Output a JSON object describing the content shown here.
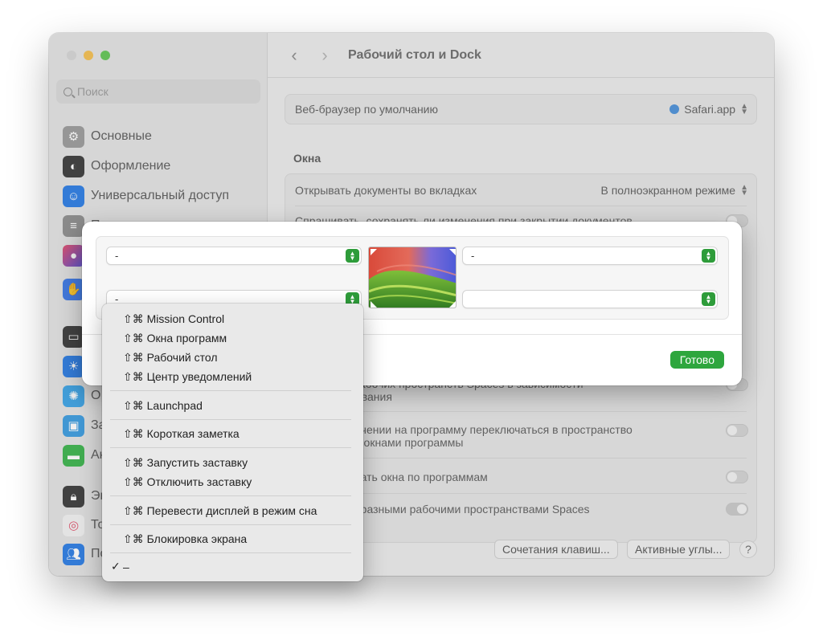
{
  "window": {
    "title": "Рабочий стол и Dock",
    "back_icon": "chevron-left-icon",
    "forward_icon": "chevron-right-icon"
  },
  "sidebar": {
    "search_placeholder": "Поиск",
    "items": [
      {
        "label": "Основные",
        "icon": "gear-icon",
        "color": "#9a9a9a"
      },
      {
        "label": "Оформление",
        "icon": "appearance-icon",
        "color": "#3a3a3a"
      },
      {
        "label": "Универсальный доступ",
        "icon": "accessibility-icon",
        "color": "#2a7be4"
      },
      {
        "label": "П",
        "icon": "control-center-icon",
        "color": "#8e8e8e"
      },
      {
        "label": "",
        "icon": "siri-icon",
        "color": "#c8408e"
      },
      {
        "label": "",
        "icon": "privacy-hand-icon",
        "color": "#3b78e7"
      },
      {
        "label": "",
        "icon": "desktop-dock-icon",
        "color": "#3a3a3a"
      },
      {
        "label": "",
        "icon": "displays-icon",
        "color": "#2a7be4"
      },
      {
        "label": "О",
        "icon": "screensaver-icon",
        "color": "#3ba3e6"
      },
      {
        "label": "За",
        "icon": "wallpaper-icon",
        "color": "#3a9be0"
      },
      {
        "label": "Ак",
        "icon": "battery-icon",
        "color": "#3ab34a"
      },
      {
        "label": "Эк",
        "icon": "lock-icon",
        "color": "#3a3a3a"
      },
      {
        "label": "То",
        "icon": "touch-id-icon",
        "color": "#f2f2f2"
      },
      {
        "label": "По",
        "icon": "users-icon",
        "color": "#2a7be4"
      }
    ]
  },
  "settings": {
    "browser_label": "Веб-браузер по умолчанию",
    "browser_value": "Safari.app",
    "windows_title": "Окна",
    "tabs_label": "Открывать документы во вкладках",
    "tabs_value": "В полноэкранном режиме",
    "ask_save_label": "Спрашивать, сохранять ли изменения при закрытии документов",
    "spaces_rearrange_label_1": "...ложение рабочих пространств Spaces в зависимости",
    "spaces_rearrange_label_2": "...о использования",
    "switch_space_label_1": "...чении на программу переключаться в пространство",
    "switch_space_label_2": "... окнами программы",
    "group_windows_label": "...ать окна по программам",
    "separate_spaces_label": "...разными рабочими пространствами Spaces",
    "shortcuts_button": "Сочетания клавиш...",
    "hot_corners_button": "Активные углы...",
    "help_button": "?"
  },
  "hot_corners": {
    "top_left": "-",
    "top_right": "-",
    "bottom_left": "-",
    "bottom_right": "",
    "done_button": "Готово"
  },
  "menu": {
    "items": [
      "⇧⌘ Mission Control",
      "⇧⌘ Окна программ",
      "⇧⌘ Рабочий стол",
      "⇧⌘ Центр уведомлений",
      "⇧⌘ Launchpad",
      "⇧⌘ Короткая заметка",
      "⇧⌘ Запустить заставку",
      "⇧⌘ Отключить заставку",
      "⇧⌘ Перевести дисплей в режим сна",
      "⇧⌘ Блокировка экрана",
      "–"
    ],
    "checkmark": "✓"
  },
  "colors": {
    "accent": "#2ea63e",
    "traffic_min": "#f4bf4f",
    "traffic_max": "#61c554"
  }
}
